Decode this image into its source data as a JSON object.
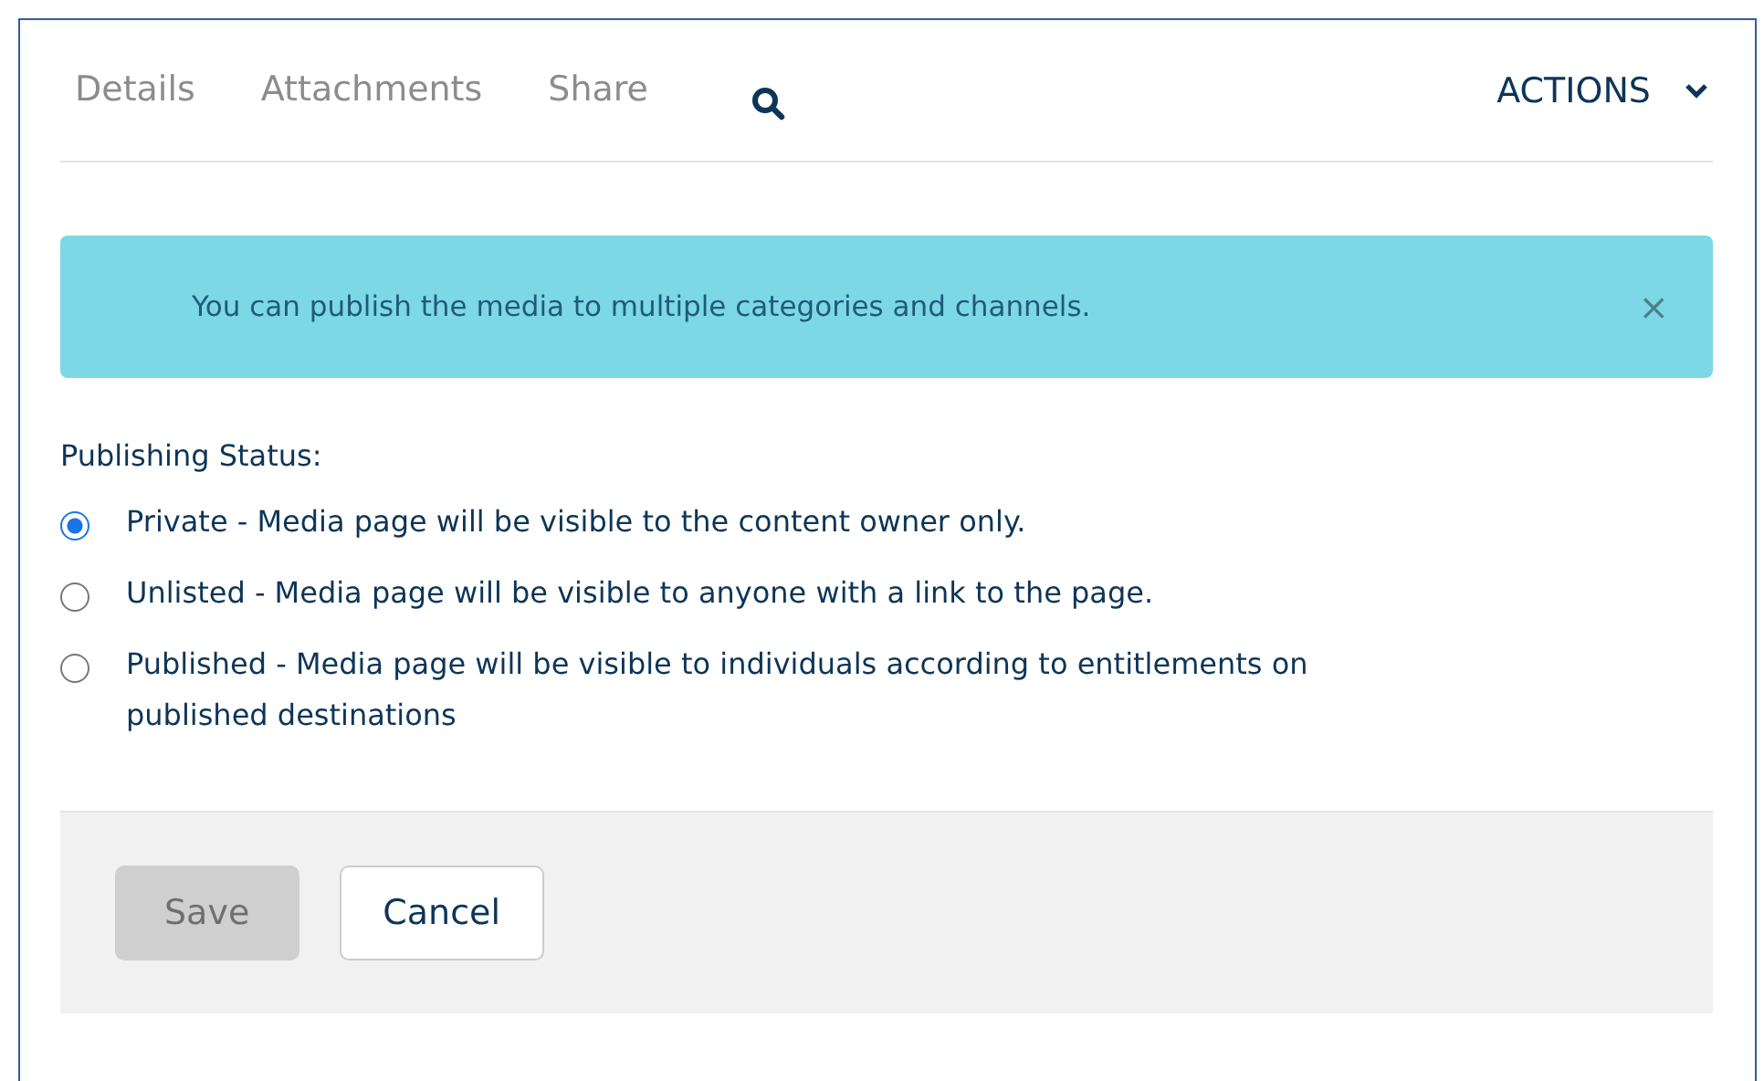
{
  "tabs": [
    {
      "label": "Details"
    },
    {
      "label": "Attachments"
    },
    {
      "label": "Share"
    }
  ],
  "actions": {
    "label": "ACTIONS"
  },
  "alert": {
    "message": "You can publish the media to multiple categories and channels.",
    "close": "×"
  },
  "publishing": {
    "label": "Publishing Status:",
    "options": [
      {
        "label": "Private - Media page will be visible to the content owner only.",
        "selected": true
      },
      {
        "label": "Unlisted - Media page will be visible to anyone with a link to the page.",
        "selected": false
      },
      {
        "label": "Published - Media page will be visible to individuals according to entitlements on published destinations",
        "selected": false
      }
    ]
  },
  "buttons": [
    {
      "label": "Save",
      "disabled": true
    },
    {
      "label": "Cancel",
      "disabled": false
    }
  ]
}
